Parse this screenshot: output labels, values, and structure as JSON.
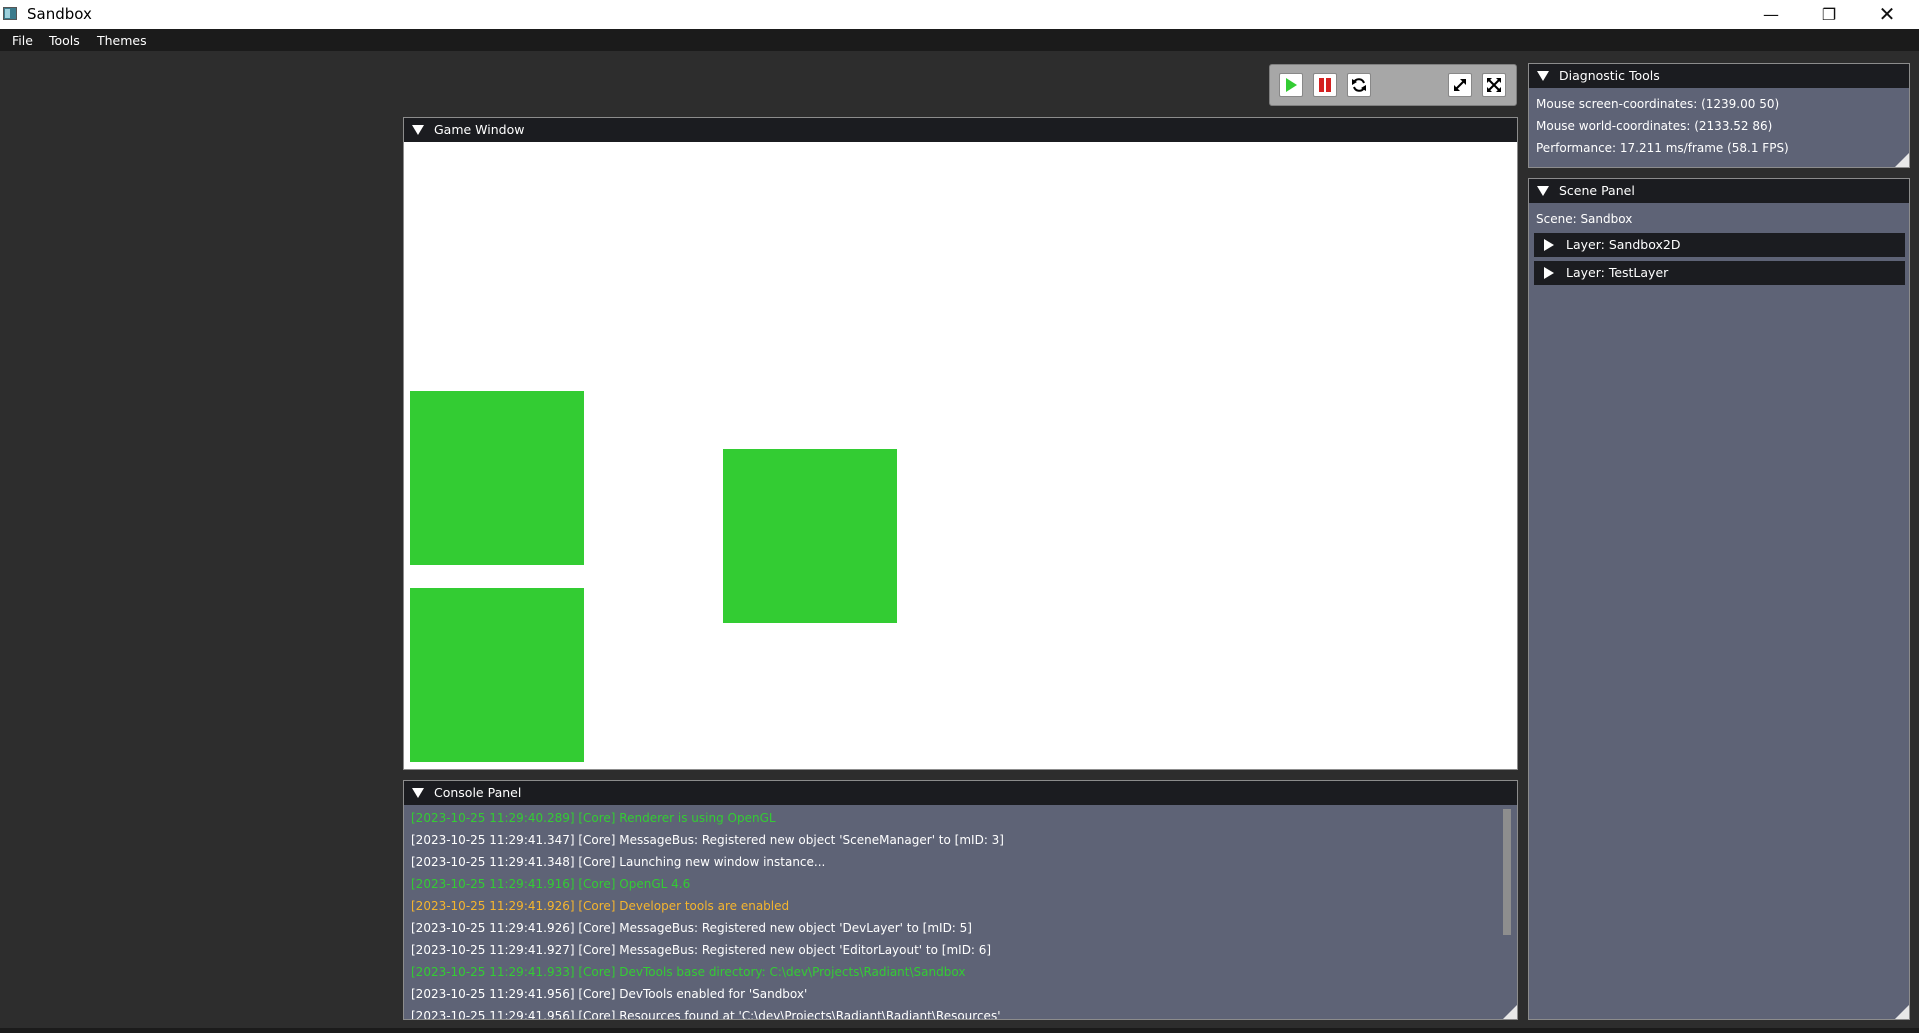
{
  "window": {
    "title": "Sandbox",
    "controls": {
      "minimize": "—",
      "maximize": "❐",
      "close": "✕"
    }
  },
  "menu": [
    "File",
    "Tools",
    "Themes"
  ],
  "toolbar": {
    "buttons": [
      "play-icon",
      "pause-icon",
      "refresh-icon",
      "expand-icon",
      "fullscreen-icon"
    ],
    "colors": {
      "play": "#33cc33",
      "pause": "#d42020"
    }
  },
  "game_window": {
    "title": "Game Window",
    "background": "#ffffff",
    "sprite_color": "#33cc33"
  },
  "diagnostics": {
    "title": "Diagnostic Tools",
    "mouse_screen": "Mouse screen-coordinates: (1239.00 50)",
    "mouse_world": "Mouse world-coordinates: (2133.52 86)",
    "performance": "Performance: 17.211 ms/frame (58.1 FPS)"
  },
  "scene": {
    "title": "Scene Panel",
    "scene_label": "Scene: Sandbox",
    "layers": [
      "Layer: Sandbox2D",
      "Layer: TestLayer"
    ]
  },
  "console": {
    "title": "Console Panel",
    "lines": [
      {
        "text": "[2023-10-25 11:29:40.289] [Core] Renderer is using OpenGL",
        "color": "#33cc33"
      },
      {
        "text": "[2023-10-25 11:29:41.347] [Core] MessageBus: Registered new object 'SceneManager' to [mID: 3]",
        "color": "#ffffff"
      },
      {
        "text": "[2023-10-25 11:29:41.348] [Core] Launching new window instance...",
        "color": "#ffffff"
      },
      {
        "text": "[2023-10-25 11:29:41.916] [Core] OpenGL 4.6",
        "color": "#33cc33"
      },
      {
        "text": "[2023-10-25 11:29:41.926] [Core] Developer tools are enabled",
        "color": "#f5b52e"
      },
      {
        "text": "[2023-10-25 11:29:41.926] [Core] MessageBus: Registered new object 'DevLayer' to [mID: 5]",
        "color": "#ffffff"
      },
      {
        "text": "[2023-10-25 11:29:41.927] [Core] MessageBus: Registered new object 'EditorLayout' to [mID: 6]",
        "color": "#ffffff"
      },
      {
        "text": "[2023-10-25 11:29:41.933] [Core] DevTools base directory: C:\\dev\\Projects\\Radiant\\Sandbox",
        "color": "#33cc33"
      },
      {
        "text": "[2023-10-25 11:29:41.956] [Core] DevTools enabled for 'Sandbox'",
        "color": "#ffffff"
      },
      {
        "text": "[2023-10-25 11:29:41.956] [Core] Resources found at 'C:\\dev\\Projects\\Radiant\\Radiant\\Resources'",
        "color": "#ffffff"
      }
    ]
  }
}
